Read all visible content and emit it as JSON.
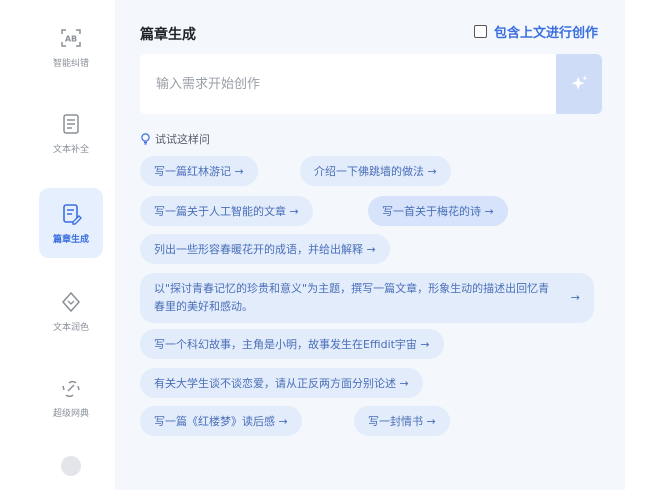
{
  "sidebar": {
    "items": [
      {
        "label": "智能纠错",
        "icon": "ab-scan-icon"
      },
      {
        "label": "文本补全",
        "icon": "document-icon"
      },
      {
        "label": "篇章生成",
        "icon": "document-edit-icon",
        "active": true
      },
      {
        "label": "文本润色",
        "icon": "diamond-icon"
      },
      {
        "label": "超级网典",
        "icon": "link-icon"
      }
    ]
  },
  "main": {
    "title": "篇章生成",
    "include_context": "包含上文进行创作",
    "input_placeholder": "输入需求开始创作",
    "hint_label": "试试这样问",
    "suggestions": [
      "写一篇红林游记 →",
      "介绍一下佛跳墙的做法 →",
      "写一篇关于人工智能的文章 →",
      "写一首关于梅花的诗 →",
      "列出一些形容春暖花开的成语，并给出解释 →",
      "以\"探讨青春记忆的珍贵和意义\"为主题，撰写一篇文章，形象生动的描述出回忆青春里的美好和感动。",
      "写一个科幻故事，主角是小明，故事发生在Effidit宇宙 →",
      "有关大学生谈不谈恋爱，请从正反两方面分别论述 →",
      "写一篇《红楼梦》读后感 →",
      "写一封情书 →"
    ],
    "long_arrow": "→"
  },
  "colors": {
    "accent": "#3b6fe0",
    "chip_bg": "#e3ecfb",
    "panel_bg": "#f4f7fc"
  }
}
